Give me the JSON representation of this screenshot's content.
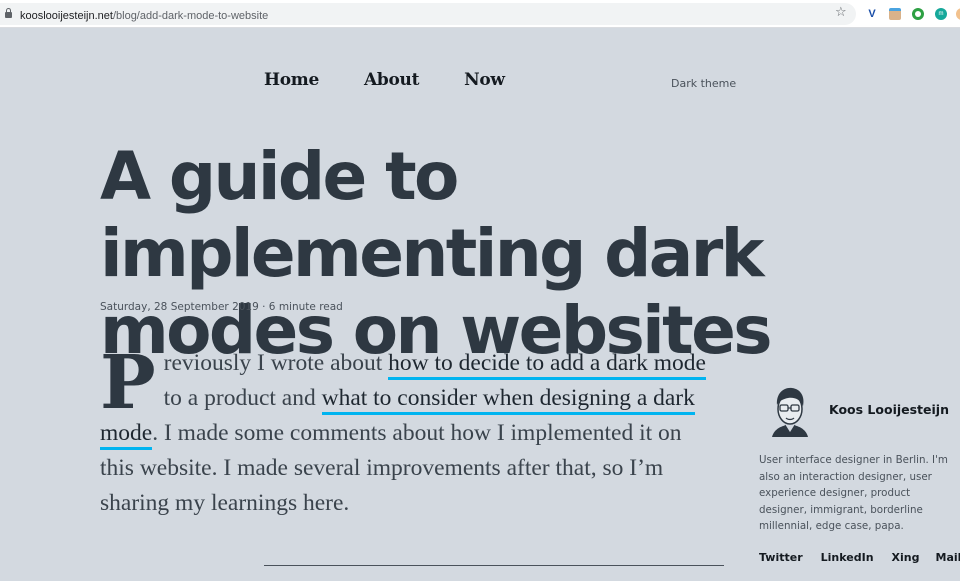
{
  "browser": {
    "url_host": "kooslooijesteijn.net",
    "url_path": "/blog/add-dark-mode-to-website",
    "extensions": [
      "vimeo-like-v-icon",
      "face-extension-icon",
      "green-circle-extension-icon",
      "teal-m-extension-icon"
    ],
    "teal_ext_label": "m"
  },
  "nav": {
    "items": [
      {
        "label": "Home"
      },
      {
        "label": "About"
      },
      {
        "label": "Now"
      }
    ],
    "theme_toggle": "Dark theme"
  },
  "article": {
    "title": "A guide to implementing dark modes on websites",
    "meta": "Saturday, 28 September 2019 · 6 minute read",
    "dropcap": "P",
    "p_text1": "reviously I wrote about ",
    "link1": "how to decide to add a dark mode",
    "p_text2": " to a product and ",
    "link2": "what to consider when designing a dark mode",
    "p_text3": ". I made some comments about how I implemented it on this website. I made several improvements after that, so I’m sharing my learnings here."
  },
  "author": {
    "name": "Koos Looijesteijn",
    "bio": "User interface designer in Berlin. I'm also an interaction designer, user experience designer, product designer, immigrant, borderline millennial, edge case, papa.",
    "social": [
      {
        "label": "Twitter"
      },
      {
        "label": "LinkedIn"
      },
      {
        "label": "Xing"
      },
      {
        "label": "Mail"
      }
    ]
  }
}
